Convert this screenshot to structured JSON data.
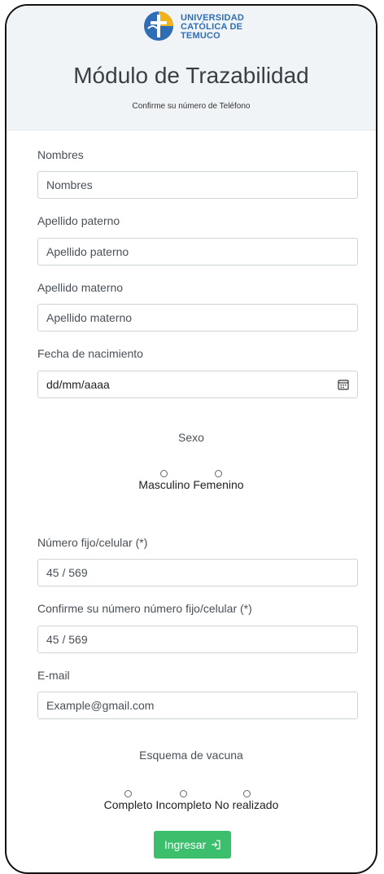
{
  "logo": {
    "line1": "UNIVERSIDAD",
    "line2": "CATÓLICA DE",
    "line3": "TEMUCO"
  },
  "header": {
    "title": "Módulo de Trazabilidad",
    "subtitle": "Confirme su número de Teléfono"
  },
  "form": {
    "nombres": {
      "label": "Nombres",
      "placeholder": "Nombres"
    },
    "apellido_paterno": {
      "label": "Apellido paterno",
      "placeholder": "Apellido paterno"
    },
    "apellido_materno": {
      "label": "Apellido materno",
      "placeholder": "Apellido materno"
    },
    "fecha": {
      "label": "Fecha de nacimiento",
      "value": "dd/mm/aaaa"
    },
    "sexo": {
      "label": "Sexo",
      "options": [
        "Masculino",
        "Femenino"
      ]
    },
    "numero": {
      "label": "Número fijo/celular (*)",
      "value": "45 / 569"
    },
    "confirmar": {
      "label": "Confirme su número número fijo/celular (*)",
      "value": "45 / 569"
    },
    "email": {
      "label": "E-mail",
      "placeholder": "Example@gmail.com"
    },
    "vacuna": {
      "label": "Esquema de vacuna",
      "options": [
        "Completo",
        "Incompleto",
        "No realizado"
      ]
    },
    "submit": {
      "label": "Ingresar",
      "icon": "login-icon"
    }
  },
  "colors": {
    "header_bg": "#f1f4f7",
    "brand_blue": "#2f6db5",
    "brand_yellow": "#f2b21a",
    "button": "#3cbf6d"
  }
}
